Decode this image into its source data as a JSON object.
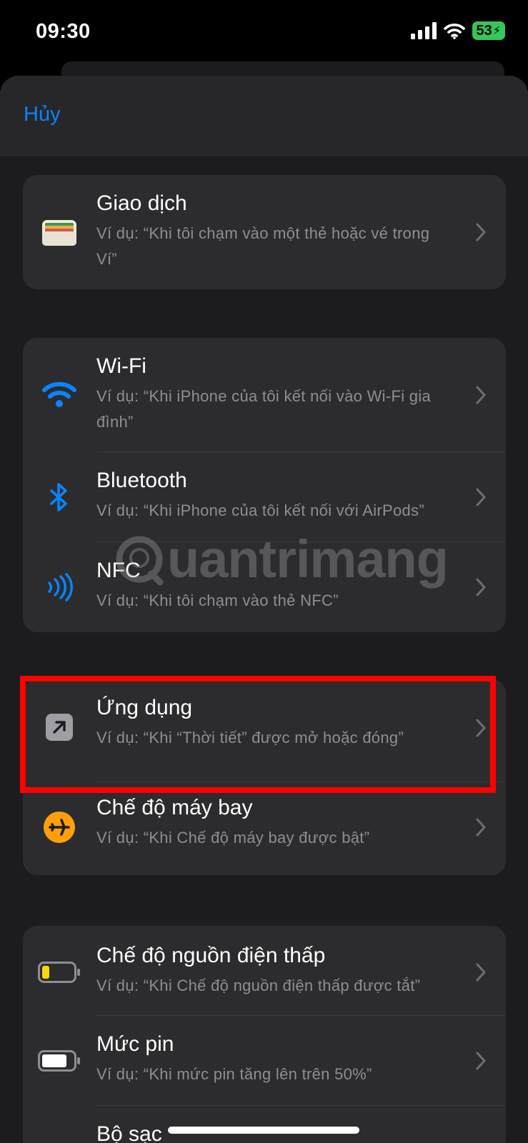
{
  "status_bar": {
    "time": "09:30",
    "battery": "53",
    "icons": [
      "cellular-signal-icon",
      "wifi-icon",
      "battery-charging-icon"
    ]
  },
  "nav": {
    "cancel_label": "Hủy"
  },
  "groups": [
    {
      "rows": [
        {
          "title": "Giao dịch",
          "subtitle": "Ví dụ: “Khi tôi chạm vào một thẻ hoặc vé trong Ví”",
          "icon": "wallet-icon"
        }
      ]
    },
    {
      "rows": [
        {
          "title": "Wi-Fi",
          "subtitle": "Ví dụ: “Khi iPhone của tôi kết nối vào Wi-Fi gia đình”",
          "icon": "wifi-icon"
        },
        {
          "title": "Bluetooth",
          "subtitle": "Ví dụ: “Khi iPhone của tôi kết nối với AirPods”",
          "icon": "bluetooth-icon"
        },
        {
          "title": "NFC",
          "subtitle": "Ví dụ: “Khi tôi chạm vào thẻ NFC”",
          "icon": "nfc-icon"
        }
      ]
    },
    {
      "rows": [
        {
          "title": "Ứng dụng",
          "subtitle": "Ví dụ: “Khi “Thời tiết” được mở hoặc đóng”",
          "icon": "app-arrow-icon"
        },
        {
          "title": "Chế độ máy bay",
          "subtitle": "Ví dụ: “Khi Chế độ máy bay được bật”",
          "icon": "airplane-icon"
        }
      ]
    },
    {
      "rows": [
        {
          "title": "Chế độ nguồn điện thấp",
          "subtitle": "Ví dụ: “Khi Chế độ nguồn điện thấp được tắt”",
          "icon": "low-power-battery-icon"
        },
        {
          "title": "Mức pin",
          "subtitle": "Ví dụ: “Khi mức pin tăng lên trên 50%”",
          "icon": "battery-level-icon"
        },
        {
          "title": "Bộ sạc",
          "subtitle": "",
          "icon": "charger-icon"
        }
      ]
    }
  ],
  "watermark": "uantrimang",
  "colors": {
    "accent": "#0a84ff",
    "highlight": "#ff0000",
    "airplane": "#ff9f0a",
    "low_power": "#ffd60a"
  }
}
